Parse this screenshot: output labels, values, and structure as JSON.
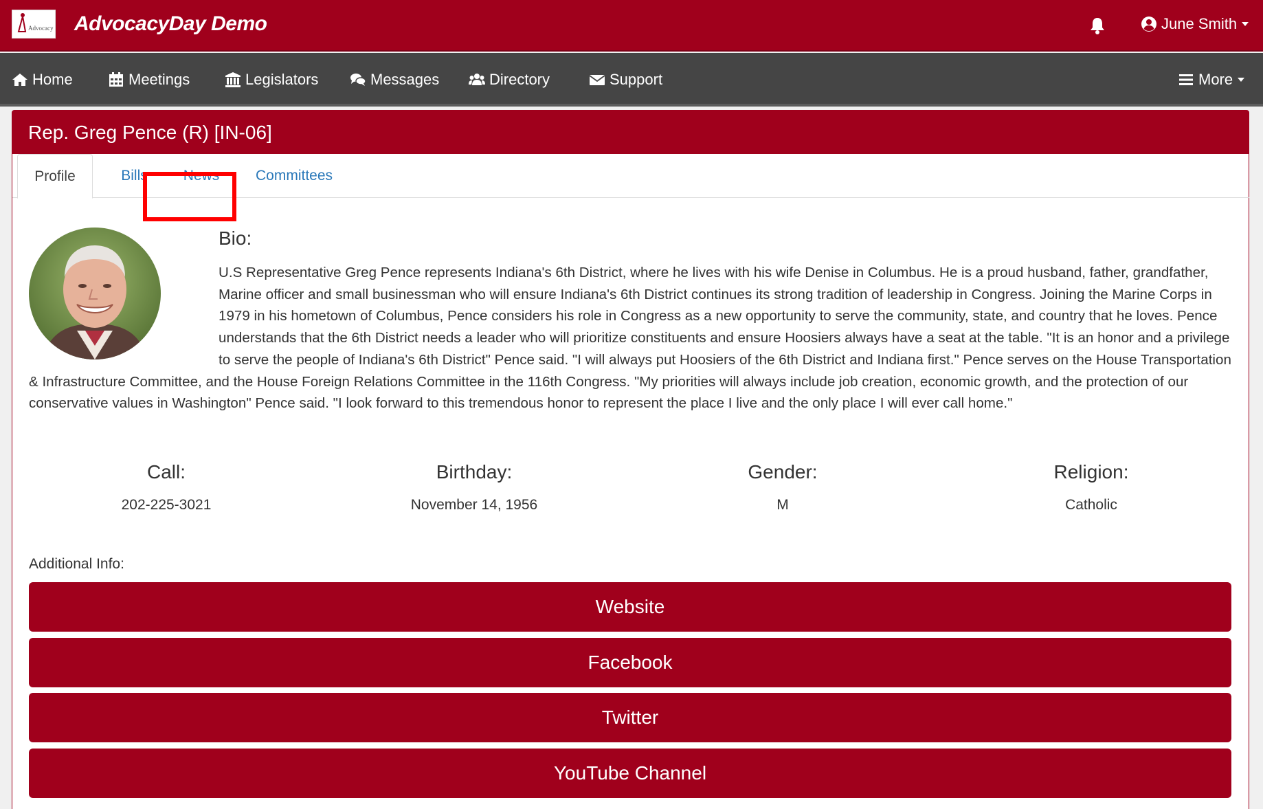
{
  "app": {
    "brand": "AdvocacyDay Demo",
    "logo_text": "Advocacy",
    "user_name": "June Smith"
  },
  "nav": {
    "items": [
      {
        "label": "Home",
        "icon": "home-icon"
      },
      {
        "label": "Meetings",
        "icon": "calendar-icon"
      },
      {
        "label": "Legislators",
        "icon": "building-icon"
      },
      {
        "label": "Messages",
        "icon": "comments-icon"
      },
      {
        "label": "Directory",
        "icon": "users-icon"
      },
      {
        "label": "Support",
        "icon": "envelope-icon"
      }
    ],
    "more_label": "More"
  },
  "legislator": {
    "title": "Rep. Greg Pence (R) [IN-06]",
    "tabs": [
      "Profile",
      "Bills",
      "News",
      "Committees"
    ],
    "active_tab": "Profile",
    "bio_heading": "Bio:",
    "bio": "U.S Representative Greg Pence represents Indiana's 6th District, where he lives with his wife Denise in Columbus. He is a proud husband, father, grandfather, Marine officer and small businessman who will ensure Indiana's 6th District continues its strong tradition of leadership in Congress. Joining the Marine Corps in 1979 in his hometown of Columbus, Pence considers his role in Congress as a new opportunity to serve the community, state, and country that he loves. Pence understands that the 6th District needs a leader who will prioritize constituents and ensure Hoosiers always have a seat at the table. \"It is an honor and a privilege to serve the people of Indiana's 6th District\" Pence said. \"I will always put Hoosiers of the 6th District and Indiana first.\" Pence serves on the House Transportation & Infrastructure Committee, and the House Foreign Relations Committee in the 116th Congress. \"My priorities will always include job creation, economic growth, and the protection of our conservative values in Washington\" Pence said. \"I look forward to this tremendous honor to represent the place I live and the only place I will ever call home.\"",
    "stats": [
      {
        "label": "Call:",
        "value": "202-225-3021"
      },
      {
        "label": "Birthday:",
        "value": "November 14, 1956"
      },
      {
        "label": "Gender:",
        "value": "M"
      },
      {
        "label": "Religion:",
        "value": "Catholic"
      }
    ],
    "additional_info_label": "Additional Info:",
    "links": [
      "Website",
      "Facebook",
      "Twitter",
      "YouTube Channel"
    ]
  },
  "colors": {
    "brand_red": "#a0001c",
    "nav_gray": "#454545",
    "link_blue": "#2a78b9",
    "highlight": "#ff0000"
  }
}
